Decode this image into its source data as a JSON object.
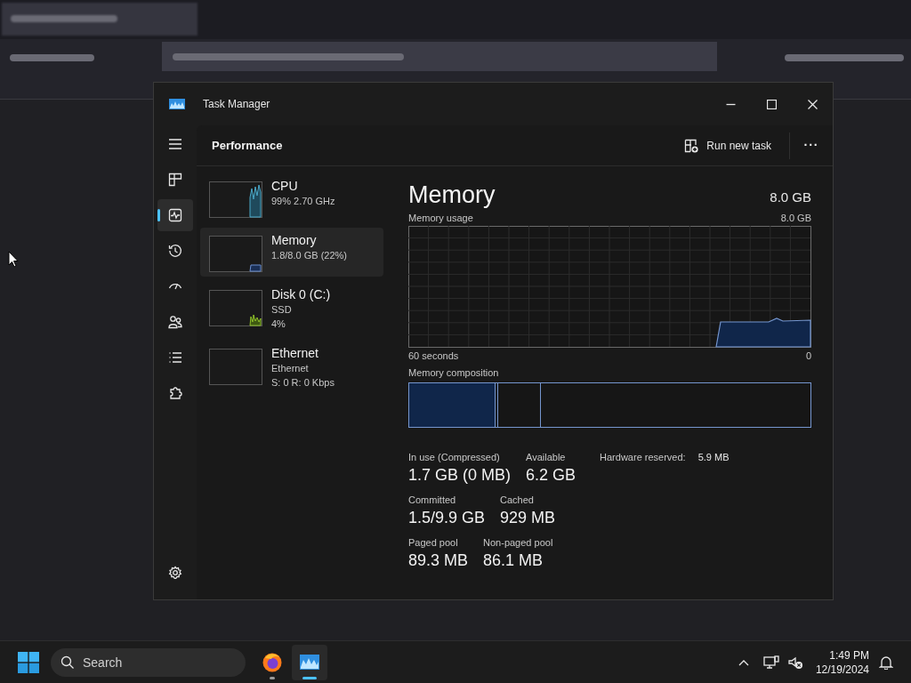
{
  "window": {
    "title": "Task Manager"
  },
  "nav": [
    {
      "kind": "menu",
      "selected": false
    },
    {
      "kind": "processes",
      "selected": false
    },
    {
      "kind": "performance",
      "selected": true
    },
    {
      "kind": "history",
      "selected": false
    },
    {
      "kind": "startup",
      "selected": false
    },
    {
      "kind": "users",
      "selected": false
    },
    {
      "kind": "details",
      "selected": false
    },
    {
      "kind": "services",
      "selected": false
    },
    {
      "kind": "settings",
      "selected": false
    }
  ],
  "header": {
    "title": "Performance",
    "run_new_task": "Run new task",
    "more": "···"
  },
  "devices": [
    {
      "kind": "cpu",
      "name": "CPU",
      "lines": [
        "99% 2.70 GHz"
      ],
      "selected": false
    },
    {
      "kind": "memory",
      "name": "Memory",
      "lines": [
        "1.8/8.0 GB (22%)"
      ],
      "selected": true
    },
    {
      "kind": "disk",
      "name": "Disk 0 (C:)",
      "lines": [
        "SSD",
        "4%"
      ],
      "selected": false
    },
    {
      "kind": "ethernet",
      "name": "Ethernet",
      "lines": [
        "Ethernet",
        "S: 0 R: 0 Kbps"
      ],
      "selected": false
    }
  ],
  "detail": {
    "title": "Memory",
    "total": "8.0 GB",
    "usage_label": "Memory usage",
    "usage_max": "8.0 GB",
    "time_label": "60 seconds",
    "usage_min": "0",
    "composition_label": "Memory composition",
    "hardware_reserved": {
      "label": "Hardware reserved:",
      "value": "5.9 MB"
    },
    "stats": [
      [
        {
          "label": "In use (Compressed)",
          "value": "1.7 GB (0 MB)"
        },
        {
          "label": "Available",
          "value": "6.2 GB"
        }
      ],
      [
        {
          "label": "Committed",
          "value": "1.5/9.9 GB"
        },
        {
          "label": "Cached",
          "value": "929 MB"
        }
      ],
      [
        {
          "label": "Paged pool",
          "value": "89.3 MB"
        },
        {
          "label": "Non-paged pool",
          "value": "86.1 MB"
        }
      ]
    ]
  },
  "taskbar": {
    "search": {
      "placeholder": "Search"
    },
    "apps": [
      {
        "kind": "firefox",
        "selected": false
      },
      {
        "kind": "taskmanager",
        "selected": true
      }
    ],
    "time": "1:49 PM",
    "date": "12/19/2024"
  }
}
